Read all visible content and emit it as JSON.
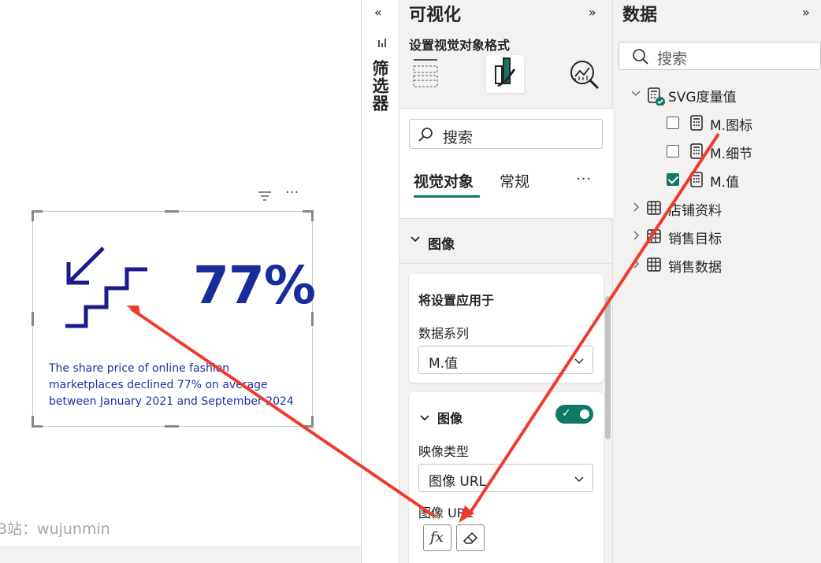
{
  "canvas": {
    "visual": {
      "value_text": "77%",
      "caption": "The share price of online fashion marketplaces declined 77% on average between January 2021 and September 2024",
      "graphic_icon": "stairs-down-arrow-icon",
      "value_color": "#182d9a"
    },
    "watermark": "B站：wujunmin",
    "header_more": "···"
  },
  "filters": {
    "title": "筛选器",
    "collapse_glyph": "«"
  },
  "visualizations": {
    "title": "可视化",
    "expand_glyph": "»",
    "subtitle": "设置视觉对象格式",
    "tabs": [
      {
        "icon": "build-visual-icon"
      },
      {
        "icon": "format-paintbrush-icon"
      },
      {
        "icon": "analytics-magnifier-icon"
      }
    ],
    "search_placeholder": "搜索",
    "subtabs": [
      "视觉对象",
      "常规"
    ],
    "more": "···",
    "section": "图像",
    "apply_card": {
      "title": "将设置应用于",
      "series_label": "数据系列",
      "series_value": "M.值"
    },
    "image_card": {
      "title": "图像",
      "toggle_on": true,
      "type_label": "映像类型",
      "type_value": "图像 URL",
      "url_label": "图像 URL",
      "fx_button": "fx",
      "fx_icon": "fx-icon",
      "eraser_icon": "eraser-icon"
    }
  },
  "data": {
    "title": "数据",
    "expand_glyph": "»",
    "search_placeholder": "搜索",
    "tree": {
      "root": "SVG度量值",
      "measures": [
        {
          "label": "M.图标",
          "checked": false
        },
        {
          "label": "M.细节",
          "checked": false
        },
        {
          "label": "M.值",
          "checked": true
        }
      ],
      "tables": [
        "店铺资料",
        "销售目标",
        "销售数据"
      ]
    }
  },
  "annotation_color": "#ef3b2d"
}
